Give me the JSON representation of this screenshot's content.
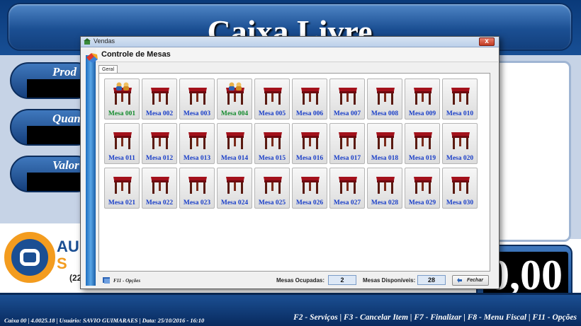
{
  "app": {
    "banner_title": "Caixa Livre",
    "fields": [
      {
        "label": "Prod"
      },
      {
        "label": "Quan"
      },
      {
        "label": "Valor"
      }
    ],
    "logo": {
      "text_top": "AU",
      "text_bottom": "S",
      "small": "(22"
    },
    "total": "0,00",
    "status_left": "Caixa 00  |  4.0025.18  |  Usuário: SAVIO GUIMARAES  |  Data: 25/10/2016 - 16:10",
    "status_right": "F2 - Serviços | F3 - Cancelar Item | F7 - Finalizar | F8 - Menu Fiscal | F11 - Opções"
  },
  "dialog": {
    "window_title": "Vendas",
    "close_glyph": "x",
    "header_title": "Controle de Mesas",
    "tab": "Geral",
    "tables": [
      {
        "name": "Mesa 001",
        "status": "occupied"
      },
      {
        "name": "Mesa 002",
        "status": "free"
      },
      {
        "name": "Mesa 003",
        "status": "free"
      },
      {
        "name": "Mesa 004",
        "status": "occupied"
      },
      {
        "name": "Mesa 005",
        "status": "free"
      },
      {
        "name": "Mesa 006",
        "status": "free"
      },
      {
        "name": "Mesa 007",
        "status": "free"
      },
      {
        "name": "Mesa 008",
        "status": "free"
      },
      {
        "name": "Mesa 009",
        "status": "free"
      },
      {
        "name": "Mesa 010",
        "status": "free"
      },
      {
        "name": "Mesa 011",
        "status": "free"
      },
      {
        "name": "Mesa 012",
        "status": "free"
      },
      {
        "name": "Mesa 013",
        "status": "free"
      },
      {
        "name": "Mesa 014",
        "status": "free"
      },
      {
        "name": "Mesa 015",
        "status": "free"
      },
      {
        "name": "Mesa 016",
        "status": "free"
      },
      {
        "name": "Mesa 017",
        "status": "free"
      },
      {
        "name": "Mesa 018",
        "status": "free"
      },
      {
        "name": "Mesa 019",
        "status": "free"
      },
      {
        "name": "Mesa 020",
        "status": "free"
      },
      {
        "name": "Mesa 021",
        "status": "free"
      },
      {
        "name": "Mesa 022",
        "status": "free"
      },
      {
        "name": "Mesa 023",
        "status": "free"
      },
      {
        "name": "Mesa 024",
        "status": "free"
      },
      {
        "name": "Mesa 025",
        "status": "free"
      },
      {
        "name": "Mesa 026",
        "status": "free"
      },
      {
        "name": "Mesa 027",
        "status": "free"
      },
      {
        "name": "Mesa 028",
        "status": "free"
      },
      {
        "name": "Mesa 029",
        "status": "free"
      },
      {
        "name": "Mesa 030",
        "status": "free"
      }
    ],
    "footer": {
      "options_label": "F11 - Opções",
      "occupied_label": "Mesas Ocupadas:",
      "occupied_value": "2",
      "available_label": "Mesas Disponíveis:",
      "available_value": "28",
      "close_label": "Fechar"
    }
  },
  "colors": {
    "free_label": "#1a3fc8",
    "occupied_label": "#138a2d",
    "table_top": "#a3111b"
  }
}
